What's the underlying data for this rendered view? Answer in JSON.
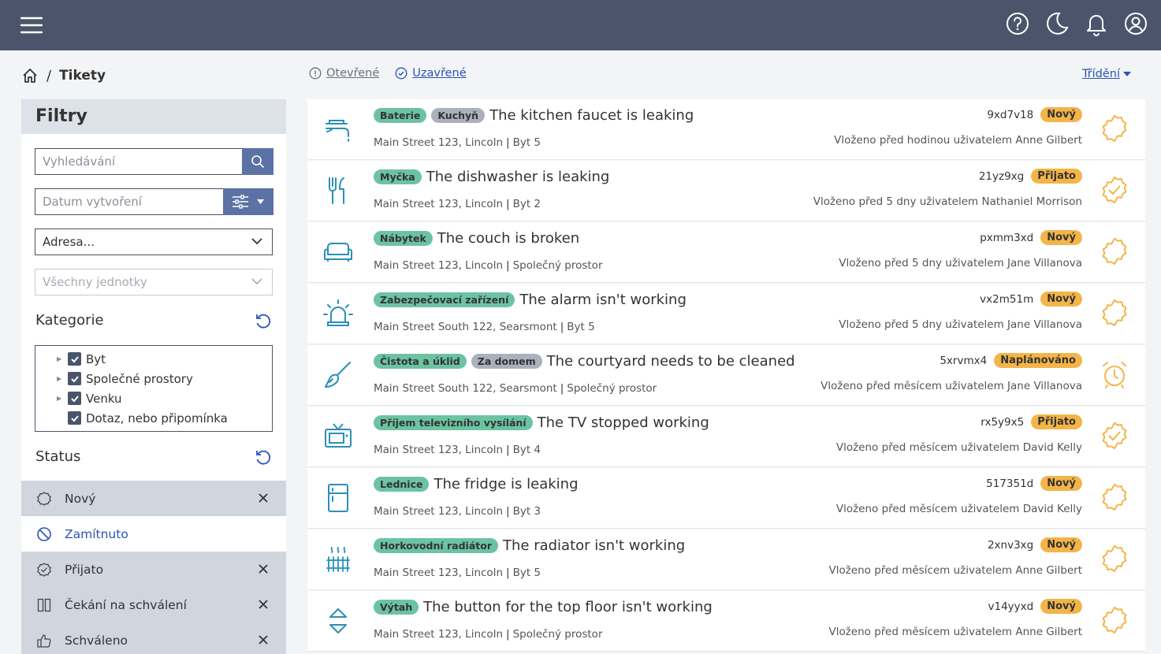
{
  "header": {
    "icons": [
      "menu-icon",
      "help-icon",
      "moon-icon",
      "bell-icon",
      "user-icon"
    ]
  },
  "breadcrumb": {
    "home_icon": "home-icon",
    "separator": "/",
    "current": "Tikety"
  },
  "tabs": {
    "open": "Otevřené",
    "closed": "Uzavřené"
  },
  "sort_label": "Třídění",
  "sidebar": {
    "title": "Filtry",
    "search_placeholder": "Vyhledávání",
    "date_placeholder": "Datum vytvoření",
    "address_value": "Adresa...",
    "units_value": "Všechny jednotky",
    "category_title": "Kategorie",
    "categories": [
      {
        "label": "Byt",
        "expandable": true,
        "checked": true
      },
      {
        "label": "Společné prostory",
        "expandable": true,
        "checked": true
      },
      {
        "label": "Venku",
        "expandable": true,
        "checked": true
      },
      {
        "label": "Dotaz, nebo připomínka",
        "expandable": false,
        "checked": true
      }
    ],
    "status_title": "Status",
    "statuses": [
      {
        "label": "Nový",
        "active": true
      },
      {
        "label": "Zamítnuto",
        "active": false
      },
      {
        "label": "Přijato",
        "active": true
      },
      {
        "label": "Čekání na schválení",
        "active": true
      },
      {
        "label": "Schváleno",
        "active": true
      }
    ]
  },
  "tickets": [
    {
      "icon": "faucet-icon",
      "tags": [
        {
          "t": "Baterie",
          "c": "green"
        },
        {
          "t": "Kuchyň",
          "c": "gray"
        }
      ],
      "title": "The kitchen faucet is leaking",
      "address": "Main Street 123, Lincoln",
      "unit": "Byt 5",
      "code": "9xd7v18",
      "status": "Nový",
      "meta": "Vloženo před hodinou uživatelem Anne Gilbert",
      "status_icon": "new-icon"
    },
    {
      "icon": "cutlery-icon",
      "tags": [
        {
          "t": "Myčka",
          "c": "green"
        }
      ],
      "title": "The dishwasher is leaking",
      "address": "Main Street 123, Lincoln",
      "unit": "Byt 2",
      "code": "21yz9xg",
      "status": "Přijato",
      "meta": "Vloženo před 5 dny uživatelem Nathaniel Morrison",
      "status_icon": "accepted-icon"
    },
    {
      "icon": "couch-icon",
      "tags": [
        {
          "t": "Nábytek",
          "c": "green"
        }
      ],
      "title": "The couch is broken",
      "address": "Main Street 123, Lincoln",
      "unit": "Společný prostor",
      "code": "pxmm3xd",
      "status": "Nový",
      "meta": "Vloženo před 5 dny uživatelem Jane Villanova",
      "status_icon": "new-icon"
    },
    {
      "icon": "alarm-light-icon",
      "tags": [
        {
          "t": "Zabezpečovací zařízení",
          "c": "green"
        }
      ],
      "title": "The alarm isn't working",
      "address": "Main Street South 122, Searsmont",
      "unit": "Byt 5",
      "code": "vx2m51m",
      "status": "Nový",
      "meta": "Vloženo před 5 dny uživatelem Jane Villanova",
      "status_icon": "new-icon"
    },
    {
      "icon": "broom-icon",
      "tags": [
        {
          "t": "Čistota a úklid",
          "c": "green"
        },
        {
          "t": "Za domem",
          "c": "gray"
        }
      ],
      "title": "The courtyard needs to be cleaned",
      "address": "Main Street South 122, Searsmont",
      "unit": "Společný prostor",
      "code": "5xrvmx4",
      "status": "Naplánováno",
      "meta": "Vloženo před měsícem uživatelem Jane Villanova",
      "status_icon": "alarm-clock-icon"
    },
    {
      "icon": "tv-icon",
      "tags": [
        {
          "t": "Příjem televizního vysílání",
          "c": "green"
        }
      ],
      "title": "The TV stopped working",
      "address": "Main Street 123, Lincoln",
      "unit": "Byt 4",
      "code": "rx5y9x5",
      "status": "Přijato",
      "meta": "Vloženo před měsícem uživatelem David Kelly",
      "status_icon": "accepted-icon"
    },
    {
      "icon": "fridge-icon",
      "tags": [
        {
          "t": "Lednice",
          "c": "green"
        }
      ],
      "title": "The fridge is leaking",
      "address": "Main Street 123, Lincoln",
      "unit": "Byt 3",
      "code": "517351d",
      "status": "Nový",
      "meta": "Vloženo před měsícem uživatelem David Kelly",
      "status_icon": "new-icon"
    },
    {
      "icon": "radiator-icon",
      "tags": [
        {
          "t": "Horkovodní radiátor",
          "c": "green"
        }
      ],
      "title": "The radiator isn't working",
      "address": "Main Street 123, Lincoln",
      "unit": "Byt 5",
      "code": "2xnv3xg",
      "status": "Nový",
      "meta": "Vloženo před měsícem uživatelem Anne Gilbert",
      "status_icon": "new-icon"
    },
    {
      "icon": "elevator-icon",
      "tags": [
        {
          "t": "Výtah",
          "c": "green"
        }
      ],
      "title": "The button for the top floor isn't working",
      "address": "Main Street 123, Lincoln",
      "unit": "Společný prostor",
      "code": "v14yyxd",
      "status": "Nový",
      "meta": "Vloženo před měsícem uživatelem Anne Gilbert",
      "status_icon": "new-icon"
    }
  ],
  "colors": {
    "header": "#4a556b",
    "accent": "#2855b7",
    "tag_green": "#6cc3a3",
    "tag_gray": "#aab1bd",
    "badge": "#f3b548",
    "status_icon": "#f3b548",
    "icon_teal": "#2a8fb8"
  }
}
